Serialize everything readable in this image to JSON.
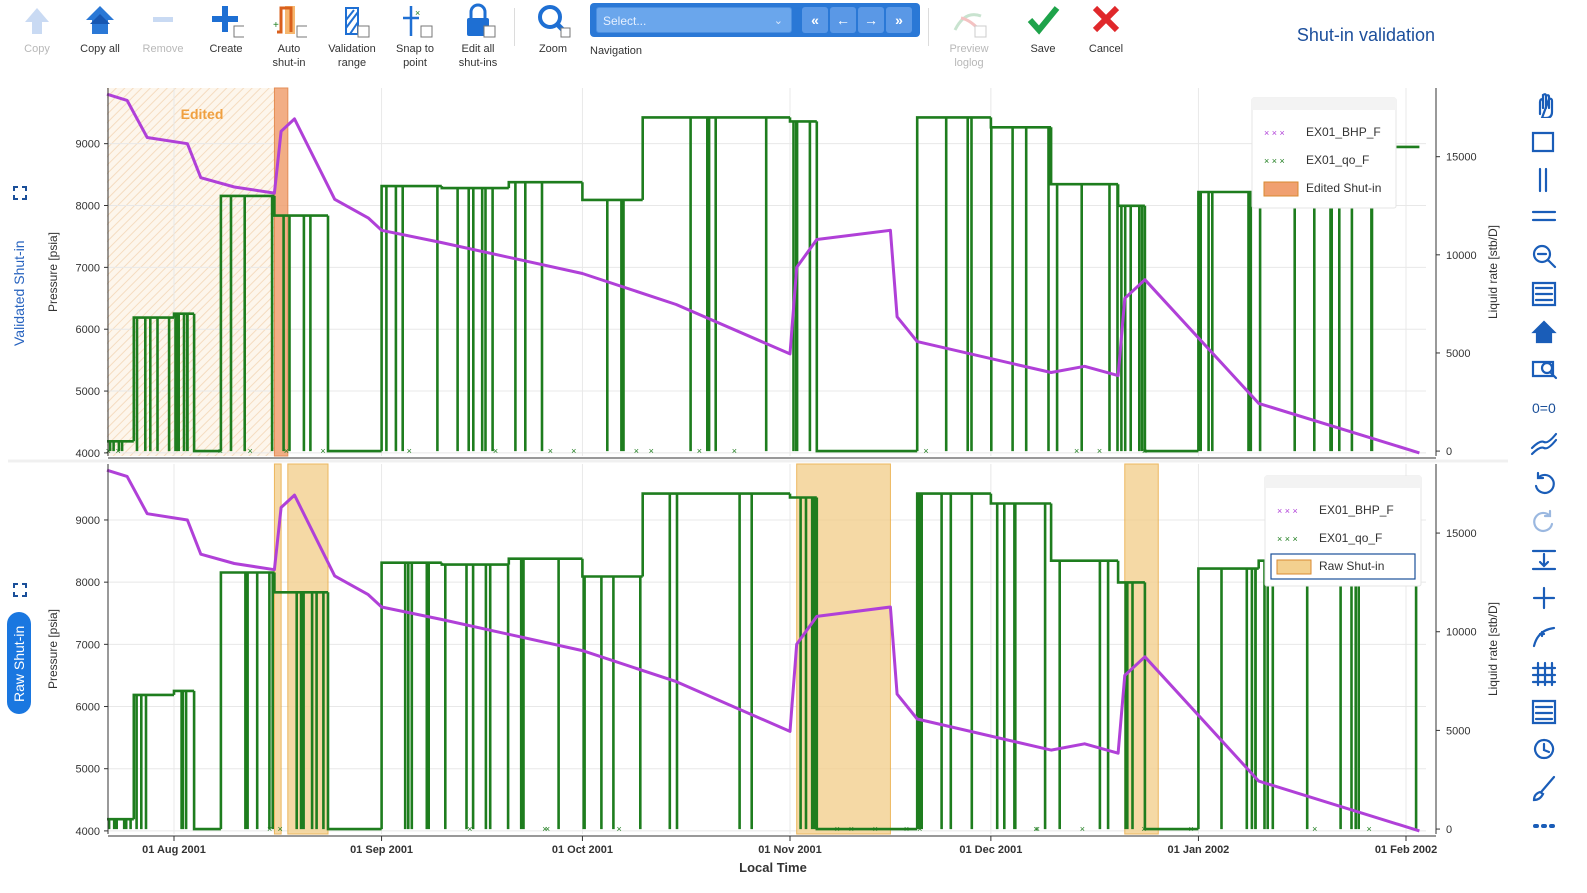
{
  "toolbar": {
    "buttons": [
      {
        "label": "Copy",
        "icon": "arrow-up-icon",
        "disabled": true
      },
      {
        "label": "Copy all",
        "icon": "double-arrow-up-icon",
        "disabled": false
      },
      {
        "label": "Remove",
        "icon": "minus-icon",
        "disabled": true
      },
      {
        "label": "Create",
        "icon": "plus-icon",
        "disabled": false
      },
      {
        "label": "Auto\nshut-in",
        "icon": "auto-shutin-icon",
        "disabled": false
      },
      {
        "label": "Validation\nrange",
        "icon": "validation-range-icon",
        "disabled": false
      },
      {
        "label": "Snap to\npoint",
        "icon": "snap-point-icon",
        "disabled": false
      },
      {
        "label": "Edit all\nshut-ins",
        "icon": "lock-icon",
        "disabled": false
      },
      {
        "label": "Zoom",
        "icon": "zoom-icon",
        "disabled": false
      },
      {
        "label": "Navigation",
        "icon": "navigation-icon",
        "disabled": false
      },
      {
        "label": "Preview\nloglog",
        "icon": "loglog-icon",
        "disabled": true
      },
      {
        "label": "Save",
        "icon": "checkmark-icon",
        "disabled": false
      },
      {
        "label": "Cancel",
        "icon": "x-icon",
        "disabled": false
      }
    ],
    "navigation": {
      "placeholder": "Select...",
      "arrows": [
        "«",
        "←",
        "→",
        "»"
      ]
    }
  },
  "page_title": "Shut-in validation",
  "panels": {
    "top_label": "Validated Shut-in",
    "bottom_label": "Raw Shut-in",
    "edited_annotation": "Edited"
  },
  "colors": {
    "pressure": "#b040d8",
    "rate": "#1e7d1e",
    "edited_fill": "#f0a070",
    "raw_fill": "#f3d08f",
    "accent": "#1a77e0"
  },
  "right_toolbar": [
    "pan-icon",
    "box-select-icon",
    "y-select-icon",
    "x-select-icon",
    "zoom-out-icon",
    "box-zoom-icon",
    "home-icon",
    "zoom-in-icon",
    "zero-icon",
    "crosshair-icon",
    "undo-icon",
    "redo-icon",
    "fit-icon",
    "point-add-icon",
    "line-tool-icon",
    "grid-icon",
    "table-icon",
    "clock-icon",
    "brush-icon",
    "more-icon"
  ],
  "right_toolbar_zero_label": "0=0",
  "chart_data": [
    {
      "type": "line",
      "panel": "Validated Shut-in",
      "xlabel": "Local Time",
      "ylabel": "Pressure [psia]",
      "y2label": "Liquid rate [stb/D]",
      "x_ticks": [
        "01 Aug 2001",
        "01 Sep 2001",
        "01 Oct 2001",
        "01 Nov 2001",
        "01 Dec 2001",
        "01 Jan 2002",
        "01 Feb 2002"
      ],
      "ylim": [
        3950,
        9900
      ],
      "y_ticks": [
        4000,
        5000,
        6000,
        7000,
        8000,
        9000
      ],
      "y2lim": [
        -250,
        18500
      ],
      "y2_ticks": [
        0,
        5000,
        10000,
        15000
      ],
      "legend": {
        "placement": "top-right",
        "entries": [
          "EX01_BHP_F",
          "EX01_qo_F",
          "Edited Shut-in"
        ]
      },
      "grid": true,
      "series": [
        {
          "name": "EX01_BHP_F",
          "axis": "left",
          "x": [
            "2001-07-22",
            "2001-07-25",
            "2001-07-28",
            "2001-08-03",
            "2001-08-05",
            "2001-08-10",
            "2001-08-16",
            "2001-08-17",
            "2001-08-19",
            "2001-08-25",
            "2001-08-30",
            "2001-09-01",
            "2001-09-10",
            "2001-10-01",
            "2001-10-15",
            "2001-11-01",
            "2001-11-02",
            "2001-11-05",
            "2001-11-16",
            "2001-11-17",
            "2001-11-20",
            "2001-12-10",
            "2001-12-15",
            "2001-12-20",
            "2001-12-21",
            "2001-12-24",
            "2002-01-10",
            "2002-02-03"
          ],
          "values": [
            9800,
            9700,
            9100,
            9000,
            8450,
            8300,
            8200,
            9200,
            9400,
            8100,
            7800,
            7600,
            7400,
            6900,
            6400,
            5600,
            7000,
            7450,
            7600,
            6200,
            5800,
            5300,
            5400,
            5250,
            6500,
            6800,
            4800,
            4000
          ]
        },
        {
          "name": "EX01_qo_F",
          "axis": "right",
          "x": [
            "2001-07-22",
            "2001-07-26",
            "2001-08-01",
            "2001-08-04",
            "2001-08-08",
            "2001-08-16",
            "2001-08-24",
            "2001-09-01",
            "2001-09-10",
            "2001-09-20",
            "2001-10-01",
            "2001-10-10",
            "2001-11-01",
            "2001-11-05",
            "2001-11-16",
            "2001-11-20",
            "2001-12-01",
            "2001-12-10",
            "2001-12-20",
            "2001-12-24",
            "2002-01-01",
            "2002-01-10",
            "2002-01-20",
            "2002-02-03"
          ],
          "values": [
            500,
            6800,
            7000,
            0,
            13000,
            12000,
            0,
            13500,
            13400,
            13700,
            12800,
            17000,
            16800,
            0,
            0,
            17000,
            16500,
            13600,
            12500,
            0,
            13200,
            13600,
            15500,
            15300
          ]
        }
      ],
      "shutins": [
        {
          "start": "2001-08-16",
          "end": "2001-08-18",
          "label": "Edited Shut-in"
        }
      ],
      "edited_range": {
        "start": "2001-07-22",
        "end": "2001-08-16"
      }
    },
    {
      "type": "line",
      "panel": "Raw Shut-in",
      "xlabel": "Local Time",
      "ylabel": "Pressure [psia]",
      "y2label": "Liquid rate [stb/D]",
      "x_ticks": [
        "01 Aug 2001",
        "01 Sep 2001",
        "01 Oct 2001",
        "01 Nov 2001",
        "01 Dec 2001",
        "01 Jan 2002",
        "01 Feb 2002"
      ],
      "ylim": [
        3950,
        9900
      ],
      "y_ticks": [
        4000,
        5000,
        6000,
        7000,
        8000,
        9000
      ],
      "y2lim": [
        -250,
        18500
      ],
      "y2_ticks": [
        0,
        5000,
        10000,
        15000
      ],
      "legend": {
        "placement": "top-right",
        "entries": [
          "EX01_BHP_F",
          "EX01_qo_F",
          "Raw Shut-in"
        ]
      },
      "grid": true,
      "series": [
        {
          "name": "EX01_BHP_F",
          "axis": "left",
          "x": [
            "2001-07-22",
            "2001-07-25",
            "2001-07-28",
            "2001-08-03",
            "2001-08-05",
            "2001-08-10",
            "2001-08-16",
            "2001-08-17",
            "2001-08-19",
            "2001-08-25",
            "2001-08-30",
            "2001-09-01",
            "2001-09-10",
            "2001-10-01",
            "2001-10-15",
            "2001-11-01",
            "2001-11-02",
            "2001-11-05",
            "2001-11-16",
            "2001-11-17",
            "2001-11-20",
            "2001-12-10",
            "2001-12-15",
            "2001-12-20",
            "2001-12-21",
            "2001-12-24",
            "2002-01-10",
            "2002-02-03"
          ],
          "values": [
            9800,
            9700,
            9100,
            9000,
            8450,
            8300,
            8200,
            9200,
            9400,
            8100,
            7800,
            7600,
            7400,
            6900,
            6400,
            5600,
            7000,
            7450,
            7600,
            6200,
            5800,
            5300,
            5400,
            5250,
            6500,
            6800,
            4800,
            4000
          ]
        },
        {
          "name": "EX01_qo_F",
          "axis": "right",
          "x": [
            "2001-07-22",
            "2001-07-26",
            "2001-08-01",
            "2001-08-04",
            "2001-08-08",
            "2001-08-16",
            "2001-08-24",
            "2001-09-01",
            "2001-09-10",
            "2001-09-20",
            "2001-10-01",
            "2001-10-10",
            "2001-11-01",
            "2001-11-05",
            "2001-11-16",
            "2001-11-20",
            "2001-12-01",
            "2001-12-10",
            "2001-12-20",
            "2001-12-24",
            "2002-01-01",
            "2002-01-10",
            "2002-01-20",
            "2002-02-03"
          ],
          "values": [
            500,
            6800,
            7000,
            0,
            13000,
            12000,
            0,
            13500,
            13400,
            13700,
            12800,
            17000,
            16800,
            0,
            0,
            17000,
            16500,
            13600,
            12500,
            0,
            13200,
            13600,
            15500,
            15300
          ]
        }
      ],
      "shutins": [
        {
          "start": "2001-08-16",
          "end": "2001-08-17",
          "label": "Raw Shut-in"
        },
        {
          "start": "2001-08-18",
          "end": "2001-08-24",
          "label": "Raw Shut-in"
        },
        {
          "start": "2001-11-02",
          "end": "2001-11-16",
          "label": "Raw Shut-in"
        },
        {
          "start": "2001-12-21",
          "end": "2001-12-26",
          "label": "Raw Shut-in"
        }
      ]
    }
  ]
}
